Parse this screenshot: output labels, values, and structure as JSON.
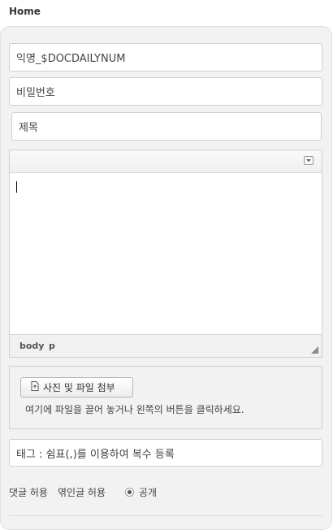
{
  "header": {
    "title": "Home"
  },
  "form": {
    "name_placeholder": "익명_$DOCDAILYNUM",
    "password_placeholder": "비밀번호",
    "title_placeholder": "제목",
    "tag_placeholder": "태그 : 쉼표(,)를 이용하여 복수 등록"
  },
  "editor": {
    "path_body": "body",
    "path_p": "p"
  },
  "attach": {
    "button_label": "사진 및 파일 첨부",
    "hint": "여기에 파일을 끌어 놓거나 왼쪽의 버튼을 클릭하세요."
  },
  "options": {
    "allow_comment": "댓글 허용",
    "allow_trackback": "엮인글 허용",
    "public_label": "공개"
  }
}
